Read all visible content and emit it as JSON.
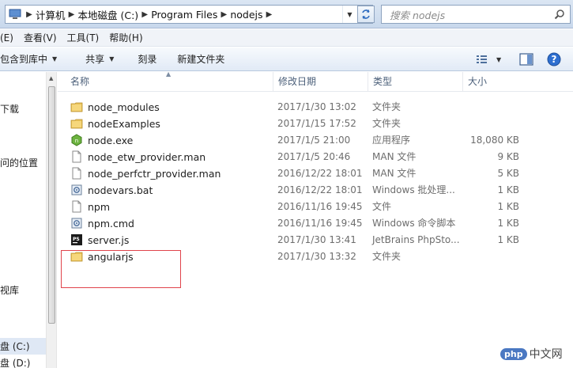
{
  "address": {
    "segments": [
      "计算机",
      "本地磁盘 (C:)",
      "Program Files",
      "nodejs"
    ]
  },
  "search": {
    "placeholder": "搜索 nodejs"
  },
  "menu": [
    {
      "label": "(E)"
    },
    {
      "label": "查看(V)"
    },
    {
      "label": "工具(T)"
    },
    {
      "label": "帮助(H)"
    }
  ],
  "toolbar": {
    "include_label": "包含到库中",
    "share_label": "共享",
    "burn_label": "刻录",
    "new_folder_label": "新建文件夹"
  },
  "nav": {
    "items": [
      {
        "label": "下载"
      },
      {
        "label": "问的位置"
      },
      {
        "label": "视库"
      },
      {
        "label": "盘 (C:)"
      },
      {
        "label": "盘 (D:)"
      }
    ]
  },
  "columns": {
    "name": "名称",
    "modified": "修改日期",
    "type": "类型",
    "size": "大小"
  },
  "files": [
    {
      "name": "node_modules",
      "modified": "2017/1/30 13:02",
      "type": "文件夹",
      "size": "",
      "icon": "folder-icon"
    },
    {
      "name": "nodeExamples",
      "modified": "2017/1/15 17:52",
      "type": "文件夹",
      "size": "",
      "icon": "folder-icon"
    },
    {
      "name": "node.exe",
      "modified": "2017/1/5 21:00",
      "type": "应用程序",
      "size": "18,080 KB",
      "icon": "nodejs-exe-icon"
    },
    {
      "name": "node_etw_provider.man",
      "modified": "2017/1/5 20:46",
      "type": "MAN 文件",
      "size": "9 KB",
      "icon": "file-icon"
    },
    {
      "name": "node_perfctr_provider.man",
      "modified": "2016/12/22 18:01",
      "type": "MAN 文件",
      "size": "5 KB",
      "icon": "file-icon"
    },
    {
      "name": "nodevars.bat",
      "modified": "2016/12/22 18:01",
      "type": "Windows 批处理...",
      "size": "1 KB",
      "icon": "batch-file-icon"
    },
    {
      "name": "npm",
      "modified": "2016/11/16 19:45",
      "type": "文件",
      "size": "1 KB",
      "icon": "file-icon"
    },
    {
      "name": "npm.cmd",
      "modified": "2016/11/16 19:45",
      "type": "Windows 命令脚本",
      "size": "1 KB",
      "icon": "batch-file-icon"
    },
    {
      "name": "server.js",
      "modified": "2017/1/30 13:41",
      "type": "JetBrains PhpSto...",
      "size": "1 KB",
      "icon": "phpstorm-file-icon"
    },
    {
      "name": "angularjs",
      "modified": "2017/1/30 13:32",
      "type": "文件夹",
      "size": "",
      "icon": "folder-icon"
    }
  ],
  "watermark": {
    "badge": "php",
    "text": "中文网"
  },
  "colors": {
    "highlight_box": "#e0444c",
    "header_text": "#4c607a",
    "folder": "#e8c25a"
  }
}
